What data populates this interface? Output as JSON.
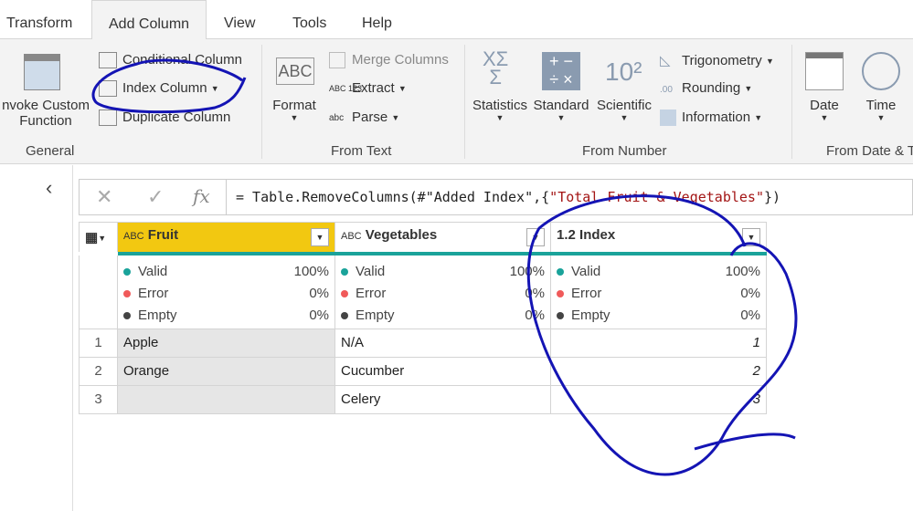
{
  "tabs": [
    {
      "label": "Transform"
    },
    {
      "label": "Add Column",
      "active": true
    },
    {
      "label": "View"
    },
    {
      "label": "Tools"
    },
    {
      "label": "Help"
    }
  ],
  "ribbon": {
    "general": {
      "label": "General",
      "invoke": "nvoke Custom",
      "invoke2": "Function",
      "conditional": "Conditional Column",
      "index": "Index Column",
      "duplicate": "Duplicate Column"
    },
    "from_text": {
      "label": "From Text",
      "format": "Format",
      "merge": "Merge Columns",
      "extract": "Extract",
      "parse": "Parse"
    },
    "from_number": {
      "label": "From Number",
      "statistics": "Statistics",
      "standard": "Standard",
      "scientific": "Scientific",
      "trig": "Trigonometry",
      "rounding": "Rounding",
      "information": "Information"
    },
    "from_date": {
      "label": "From Date & T",
      "date": "Date",
      "time": "Time"
    }
  },
  "formula": {
    "prefix": "= Table.RemoveColumns(#\"Added Index\",{",
    "string": "\"Total Fruit & Vegetables\"",
    "suffix": "})"
  },
  "table": {
    "columns": [
      {
        "type": "ABC",
        "name": "Fruit"
      },
      {
        "type": "ABC",
        "name": "Vegetables"
      },
      {
        "type": "1.2",
        "name": "Index"
      }
    ],
    "profile_labels": [
      "Valid",
      "Error",
      "Empty"
    ],
    "profile": [
      [
        "100%",
        "0%",
        "0%"
      ],
      [
        "100%",
        "0%",
        "0%"
      ],
      [
        "100%",
        "0%",
        "0%"
      ]
    ],
    "rows": [
      [
        "1",
        "Apple",
        "N/A",
        "1"
      ],
      [
        "2",
        "Orange",
        "Cucumber",
        "2"
      ],
      [
        "3",
        "",
        "Celery",
        "3"
      ]
    ]
  },
  "colors": {
    "valid": "#1aa39a",
    "error": "#f05a5a",
    "empty": "#444444",
    "annotation": "#1414b4",
    "selected_header": "#f2c811"
  }
}
